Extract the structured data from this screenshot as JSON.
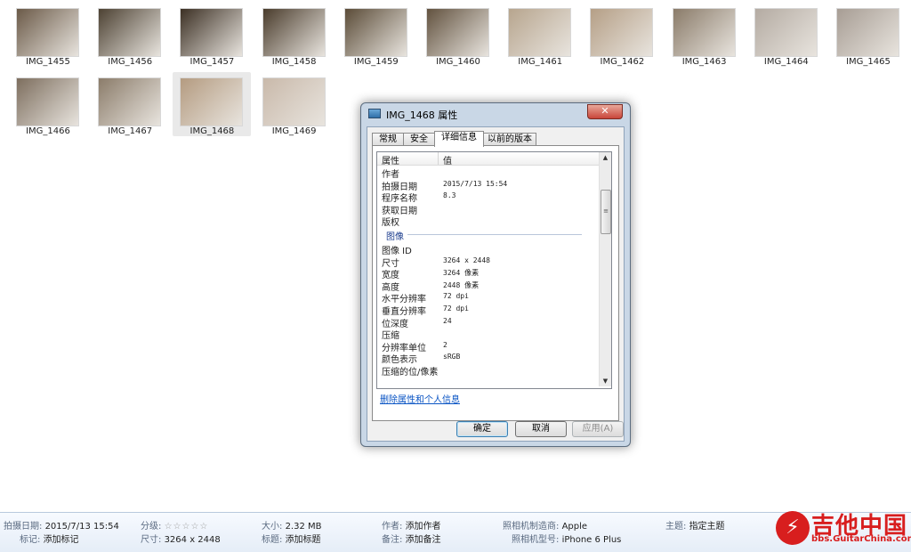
{
  "thumbnails": [
    {
      "name": "IMG_1455",
      "color": "#6b5a48"
    },
    {
      "name": "IMG_1456",
      "color": "#4d4233"
    },
    {
      "name": "IMG_1457",
      "color": "#3c3024"
    },
    {
      "name": "IMG_1458",
      "color": "#4a3c2c"
    },
    {
      "name": "IMG_1459",
      "color": "#5b4c38"
    },
    {
      "name": "IMG_1460",
      "color": "#62523f"
    },
    {
      "name": "IMG_1461",
      "color": "#b7a58e"
    },
    {
      "name": "IMG_1462",
      "color": "#b59f86"
    },
    {
      "name": "IMG_1463",
      "color": "#8a7b69"
    },
    {
      "name": "IMG_1464",
      "color": "#b4aba2"
    },
    {
      "name": "IMG_1465",
      "color": "#a79d94"
    },
    {
      "name": "IMG_1466",
      "color": "#7d6e5e"
    },
    {
      "name": "IMG_1467",
      "color": "#8b7c6a"
    },
    {
      "name": "IMG_1468",
      "color": "#b49b80",
      "selected": true
    },
    {
      "name": "IMG_1469",
      "color": "#c9b9aa"
    }
  ],
  "dialog": {
    "title": "IMG_1468 属性",
    "close": "✕",
    "tabs": [
      "常规",
      "安全",
      "详细信息",
      "以前的版本"
    ],
    "active_tab": "详细信息",
    "header": {
      "property": "属性",
      "value": "值"
    },
    "rows_top": [
      {
        "k": "作者",
        "v": ""
      },
      {
        "k": "拍摄日期",
        "v": "2015/7/13 15:54"
      },
      {
        "k": "程序名称",
        "v": "8.3"
      },
      {
        "k": "获取日期",
        "v": ""
      },
      {
        "k": "版权",
        "v": ""
      }
    ],
    "group": "图像",
    "rows_image": [
      {
        "k": "图像 ID",
        "v": ""
      },
      {
        "k": "尺寸",
        "v": "3264 x 2448"
      },
      {
        "k": "宽度",
        "v": "3264 像素"
      },
      {
        "k": "高度",
        "v": "2448 像素"
      },
      {
        "k": "水平分辨率",
        "v": "72 dpi"
      },
      {
        "k": "垂直分辨率",
        "v": "72 dpi"
      },
      {
        "k": "位深度",
        "v": "24"
      },
      {
        "k": "压缩",
        "v": ""
      },
      {
        "k": "分辨率单位",
        "v": "2"
      },
      {
        "k": "颜色表示",
        "v": "sRGB"
      },
      {
        "k": "压缩的位/像素",
        "v": ""
      }
    ],
    "link": "删除属性和个人信息",
    "buttons": {
      "ok": "确定",
      "cancel": "取消",
      "apply": "应用(A)"
    }
  },
  "details_pane": {
    "date_label": "拍摄日期:",
    "date_value": "2015/7/13 15:54",
    "tags_label": "标记:",
    "tags_value": "添加标记",
    "rating_label": "分级:",
    "rating_value": "☆☆☆☆☆",
    "dims_label": "尺寸:",
    "dims_value": "3264 x 2448",
    "size_label": "大小:",
    "size_value": "2.32 MB",
    "title_label": "标题:",
    "title_value": "添加标题",
    "author_label": "作者:",
    "author_value": "添加作者",
    "comment_label": "备注:",
    "comment_value": "添加备注",
    "maker_label": "照相机制造商:",
    "maker_value": "Apple",
    "model_label": "照相机型号:",
    "model_value": "iPhone 6 Plus",
    "subject_label": "主题:",
    "subject_value": "指定主题"
  },
  "watermark": {
    "name": "吉他中国",
    "url": "bbs.GuitarChina.com",
    "glyph": "⚡"
  }
}
